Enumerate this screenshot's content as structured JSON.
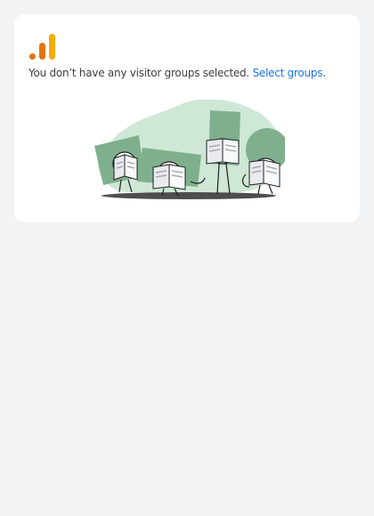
{
  "empty_state": {
    "message_prefix": "You don’t have any visitor groups selected.",
    "link_label": "Select groups",
    "message_suffix": ".",
    "logo_icon": "analytics-bars-icon",
    "illustration_icon": "people-reading-newspapers-illustration"
  },
  "colors": {
    "logo_orange": "#f9ab00",
    "logo_dark_orange": "#e37400",
    "link_blue": "#1a73e8",
    "illustration_green": "#7fb08d",
    "illustration_light_green": "#cfe7d6",
    "background": "#f1f3f4"
  }
}
